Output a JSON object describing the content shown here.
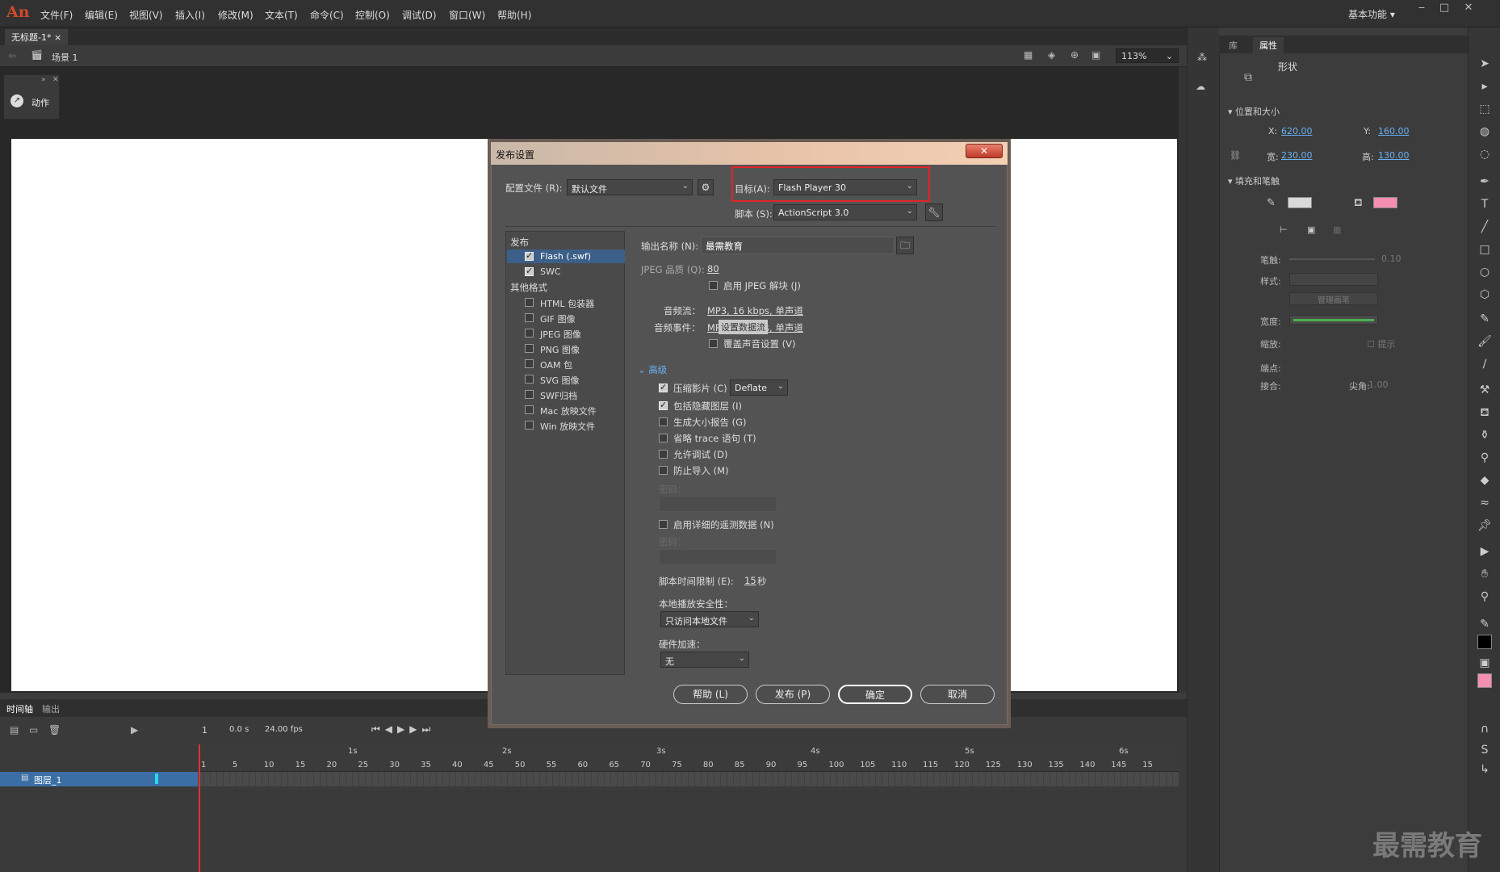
{
  "app": {
    "logo": "An",
    "menu": [
      "文件(F)",
      "编辑(E)",
      "视图(V)",
      "插入(I)",
      "修改(M)",
      "文本(T)",
      "命令(C)",
      "控制(O)",
      "调试(D)",
      "窗口(W)",
      "帮助(H)"
    ],
    "workspace": "基本功能"
  },
  "doc": {
    "tab": "无标题-1*",
    "scene": "场景 1",
    "zoom": "113%",
    "actions_panel": "动作"
  },
  "timeline": {
    "tabs": [
      "时间轴",
      "输出"
    ],
    "frame": "1",
    "time": "0.0 s",
    "fps": "24.00 fps",
    "layer": "图层_1",
    "seconds": [
      "1s",
      "2s",
      "3s",
      "4s",
      "5s",
      "6s"
    ],
    "ticks": [
      "1",
      "5",
      "10",
      "15",
      "20",
      "25",
      "30",
      "35",
      "40",
      "45",
      "50",
      "55",
      "60",
      "65",
      "70",
      "75",
      "80",
      "85",
      "90",
      "95",
      "100",
      "105",
      "110",
      "115",
      "120",
      "125",
      "130",
      "135",
      "140",
      "145",
      "15"
    ]
  },
  "props": {
    "tabs": [
      "库",
      "属性"
    ],
    "shape": "形状",
    "pos_section": "位置和大小",
    "x_label": "X:",
    "x": "620.00",
    "y_label": "Y:",
    "y": "160.00",
    "w_label": "宽:",
    "w": "230.00",
    "h_label": "高:",
    "h": "130.00",
    "fill_section": "填充和笔触",
    "stroke_label": "笔触:",
    "stroke_val": "0.10",
    "style_label": "样式:",
    "manage_btn": "管理画笔",
    "width_label": "宽度:",
    "scale_label": "缩放:",
    "hint_label": "提示",
    "cap_label": "端点:",
    "join_label": "接合:",
    "miter_label": "尖角:",
    "miter_val": "1.00",
    "fill_color": "#f48fb1",
    "stroke_color": "#d9d9d9"
  },
  "dialog": {
    "title": "发布设置",
    "close": "✕",
    "profile_label": "配置文件 (R):",
    "profile_value": "默认文件",
    "target_label": "目标(A):",
    "target_value": "Flash Player 30",
    "script_label": "脚本 (S):",
    "script_value": "ActionScript 3.0",
    "publish_header": "发布",
    "other_header": "其他格式",
    "publish_items": [
      {
        "label": "Flash (.swf)",
        "checked": true
      },
      {
        "label": "SWC",
        "checked": true
      }
    ],
    "other_items": [
      "HTML 包装器",
      "GIF 图像",
      "JPEG 图像",
      "PNG 图像",
      "OAM 包",
      "SVG 图像",
      "SWF归档",
      "Mac 放映文件",
      "Win 放映文件"
    ],
    "output_label": "输出名称 (N):",
    "output_value": "最需教育",
    "jpeg_label": "JPEG 品质 (Q):",
    "jpeg_value": "80",
    "jpeg_deblock": "启用 JPEG 解块 (J)",
    "audio_stream_label": "音频流：",
    "audio_stream_value": "MP3, 16 kbps, 单声道",
    "audio_event_label": "音频事件：",
    "audio_event_value": "MP3, 16 kbps, 单声道",
    "audio_tooltip": "设置数据流",
    "override_sound": "覆盖声音设置 (V)",
    "advanced": "高级",
    "compress": "压缩影片 (C)",
    "compress_value": "Deflate",
    "include_hidden": "包括隐藏图层 (I)",
    "size_report": "生成大小报告 (G)",
    "omit_trace": "省略  trace 语句 (T)",
    "permit_debug": "允许调试 (D)",
    "protect_import": "防止导入 (M)",
    "password": "密码：",
    "telemetry": "启用详细的遥测数据 (N)",
    "script_time_label": "脚本时间限制 (E):",
    "script_time_value": "15",
    "script_time_unit": "秒",
    "local_security_label": "本地播放安全性：",
    "local_security_value": "只访问本地文件",
    "hw_accel_label": "硬件加速：",
    "hw_accel_value": "无",
    "buttons": [
      "帮助 (L)",
      "发布 (P)",
      "确定",
      "取消"
    ]
  },
  "watermark": "最需教育"
}
